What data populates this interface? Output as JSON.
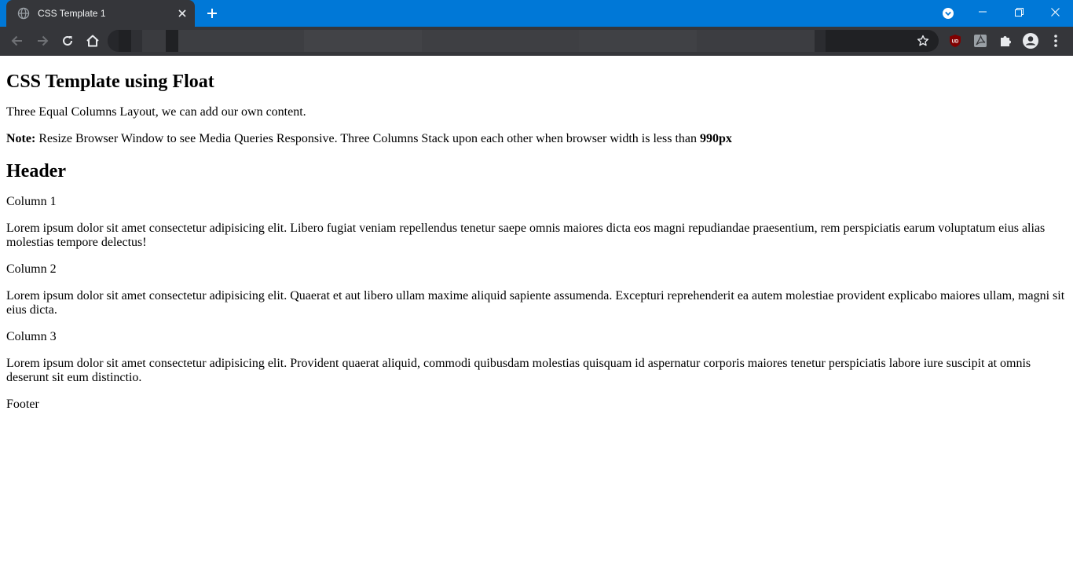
{
  "browser": {
    "tab_title": "CSS Template 1",
    "accent_color": "#0078d7",
    "icons": {
      "favicon": "globe-icon",
      "close_tab": "close-icon",
      "new_tab": "plus-icon",
      "back": "back-arrow-icon",
      "forward": "forward-arrow-icon",
      "reload": "reload-icon",
      "home": "home-icon",
      "bookmark": "star-icon",
      "ublock": "ublock-icon",
      "pdf": "pdf-icon",
      "extensions": "puzzle-icon",
      "profile": "profile-icon",
      "menu": "kebab-menu-icon"
    },
    "ublock_label": "UD"
  },
  "page": {
    "title": "CSS Template using Float",
    "intro": "Three Equal Columns Layout, we can add our own content.",
    "note_label": "Note:",
    "note_text": " Resize Browser Window to see Media Queries Responsive. Three Columns Stack upon each other when browser width is less than ",
    "note_value": "990px",
    "header": "Header",
    "columns": [
      {
        "title": "Column 1",
        "text": "Lorem ipsum dolor sit amet consectetur adipisicing elit. Libero fugiat veniam repellendus tenetur saepe omnis maiores dicta eos magni repudiandae praesentium, rem perspiciatis earum voluptatum eius alias molestias tempore delectus!"
      },
      {
        "title": "Column 2",
        "text": "Lorem ipsum dolor sit amet consectetur adipisicing elit. Quaerat et aut libero ullam maxime aliquid sapiente assumenda. Excepturi reprehenderit ea autem molestiae provident explicabo maiores ullam, magni sit eius dicta."
      },
      {
        "title": "Column 3",
        "text": "Lorem ipsum dolor sit amet consectetur adipisicing elit. Provident quaerat aliquid, commodi quibusdam molestias quisquam id aspernatur corporis maiores tenetur perspiciatis labore iure suscipit at omnis deserunt sit eum distinctio."
      }
    ],
    "footer": "Footer"
  }
}
